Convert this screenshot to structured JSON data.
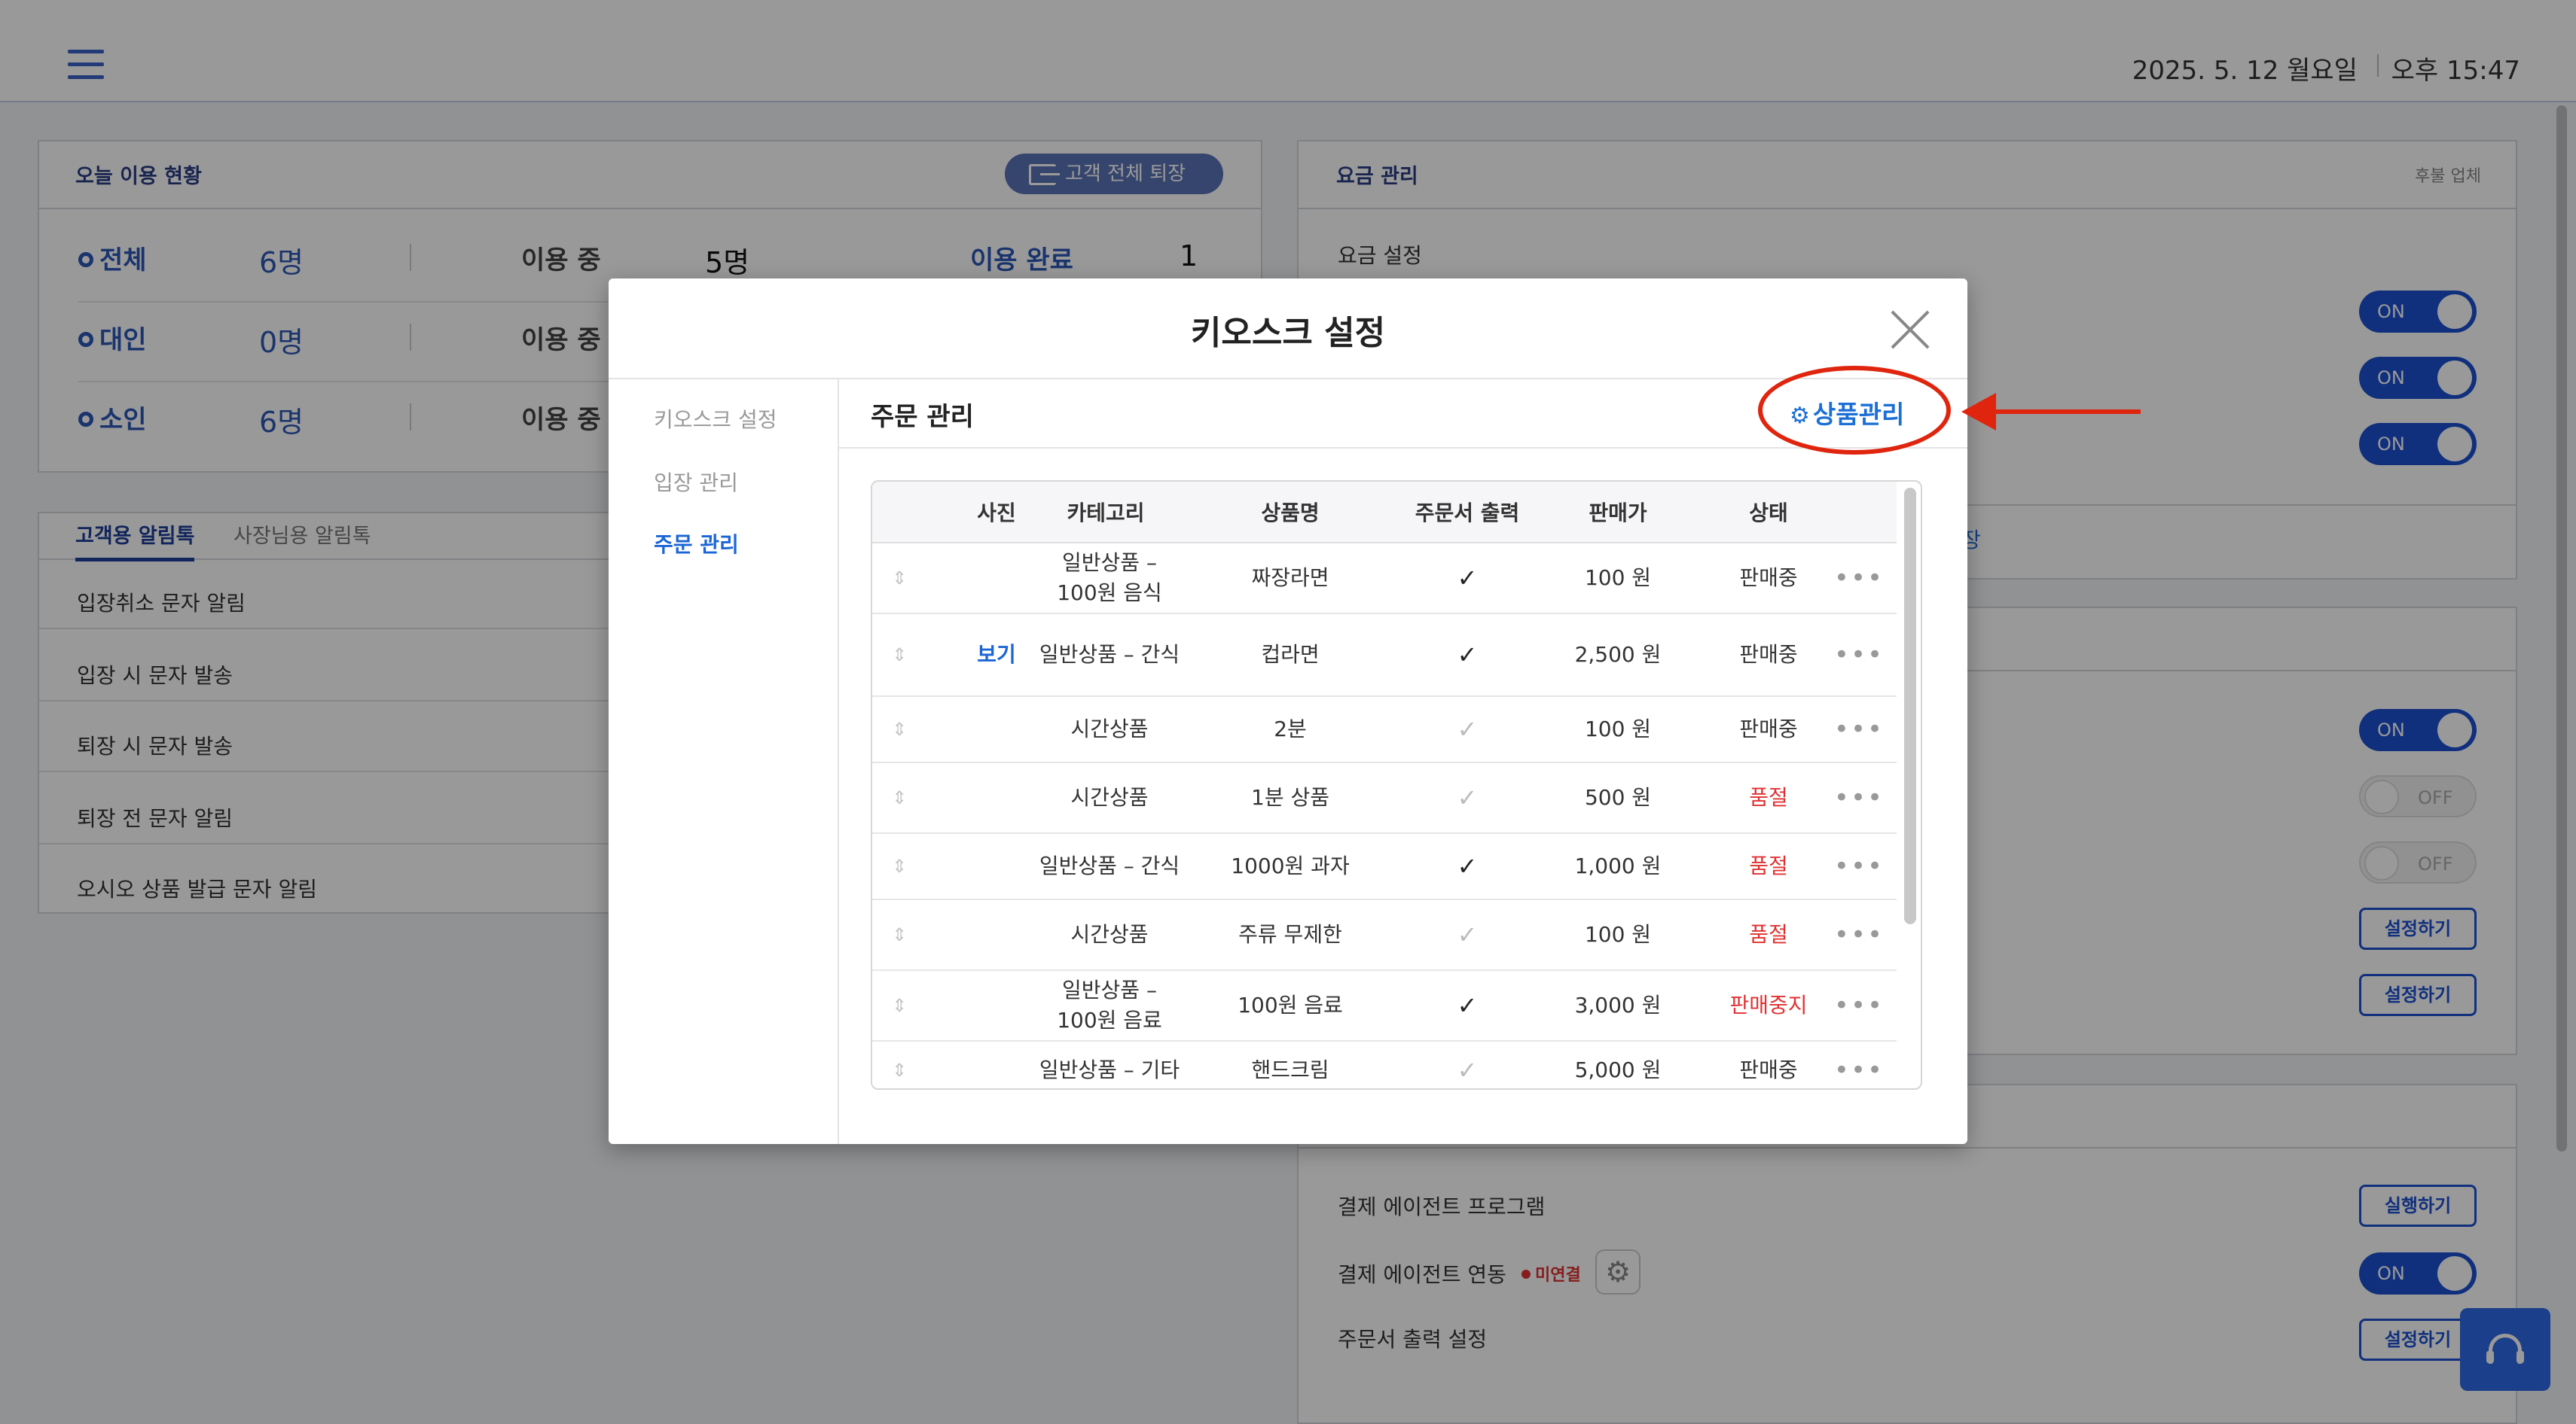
{
  "header": {
    "date": "2025. 5. 12 월요일",
    "time": "오후 15:47"
  },
  "usage": {
    "title": "오늘 이용 현황",
    "exit_all_label": "고객 전체 퇴장",
    "rows": [
      {
        "label": "전체",
        "count": "6명",
        "in_use_label": "이용 중",
        "in_use": "5명",
        "done_label": "이용 완료",
        "done": "1명"
      },
      {
        "label": "대인",
        "count": "0명",
        "in_use_label": "이용 중"
      },
      {
        "label": "소인",
        "count": "6명",
        "in_use_label": "이용 중"
      }
    ]
  },
  "alimtalk": {
    "tab_customer": "고객용 알림톡",
    "tab_owner": "사장님용 알림톡",
    "items": [
      "입장취소 문자 알림",
      "입장 시 문자 발송",
      "퇴장 시 문자 발송",
      "퇴장 전 문자 알림",
      "오시오 상품 발급 문자 알림"
    ]
  },
  "fee": {
    "title": "요금 관리",
    "badge": "후불 업체",
    "setting_label": "요금 설정",
    "partial_text": "장"
  },
  "toggles": {
    "on": "ON",
    "off": "OFF"
  },
  "actions": {
    "configure": "설정하기",
    "run": "실행하기"
  },
  "payment": {
    "agent_program": "결제 에이전트 프로그램",
    "agent_link": "결제 에이전트 연동",
    "unlinked": "미연결",
    "receipt_setting": "주문서 출력 설정"
  },
  "modal": {
    "title": "키오스크 설정",
    "side_items": [
      "키오스크 설정",
      "입장 관리",
      "주문 관리"
    ],
    "section_title": "주문 관리",
    "product_manage": "상품관리",
    "columns": [
      "사진",
      "카테고리",
      "상품명",
      "주문서 출력",
      "판매가",
      "상태"
    ],
    "rows": [
      {
        "photo": "",
        "category": "일반상품 –\n100원 음식",
        "name": "짜장라면",
        "print": true,
        "price": "100 원",
        "status": "판매중"
      },
      {
        "photo": "보기",
        "category": "일반상품 – 간식",
        "name": "컵라면",
        "print": true,
        "price": "2,500 원",
        "status": "판매중"
      },
      {
        "photo": "",
        "category": "시간상품",
        "name": "2분",
        "print": false,
        "price": "100 원",
        "status": "판매중"
      },
      {
        "photo": "",
        "category": "시간상품",
        "name": "1분 상품",
        "print": false,
        "price": "500 원",
        "status": "품절"
      },
      {
        "photo": "",
        "category": "일반상품 – 간식",
        "name": "1000원 과자",
        "print": true,
        "price": "1,000 원",
        "status": "품절"
      },
      {
        "photo": "",
        "category": "시간상품",
        "name": "주류 무제한",
        "print": false,
        "price": "100 원",
        "status": "품절"
      },
      {
        "photo": "",
        "category": "일반상품 –\n100원 음료",
        "name": "100원 음료",
        "print": true,
        "price": "3,000 원",
        "status": "판매중지"
      },
      {
        "photo": "",
        "category": "일반상품 – 기타",
        "name": "핸드크림",
        "print": false,
        "price": "5,000 원",
        "status": "판매중"
      }
    ]
  },
  "colors": {
    "accent": "#1b66d6",
    "toggle_on": "#1b4fd1",
    "annotation": "#e0250e",
    "status_alert": "#e03131"
  }
}
